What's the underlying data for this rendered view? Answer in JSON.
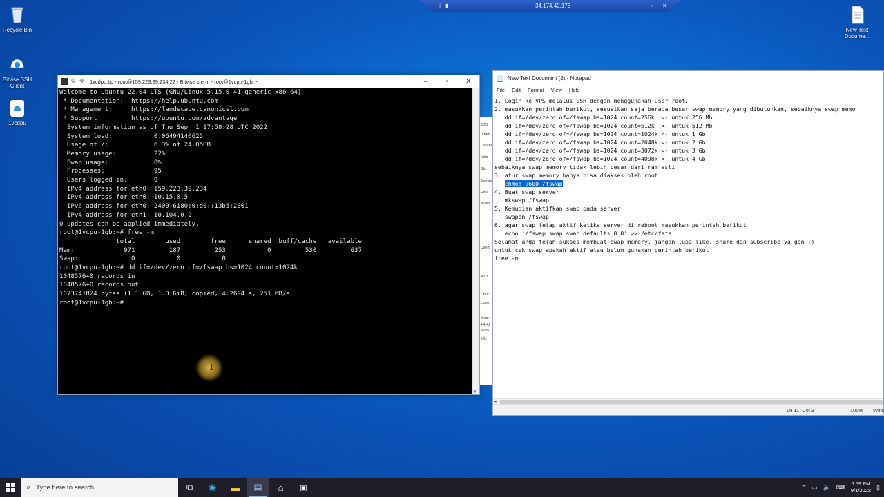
{
  "desktop": {
    "icons": [
      {
        "label": "Recycle Bin"
      },
      {
        "label": "Bitvise SSH Client"
      },
      {
        "label": "1vcdpu"
      },
      {
        "label": "New Text Docume..."
      }
    ]
  },
  "rdp_bar": {
    "host": "34.174.42.178"
  },
  "terminal": {
    "title": "1vcdpu.tlp - root@159.223.39.234:22 - Bitvise xterm - root@1vcpu-1gb: ~",
    "lines": [
      "Welcome to Ubuntu 22.04 LTS (GNU/Linux 5.15.0-41-generic x86_64)",
      "",
      " * Documentation:  https://help.ubuntu.com",
      " * Management:     https://landscape.canonical.com",
      " * Support:        https://ubuntu.com/advantage",
      "",
      "  System information as of Thu Sep  1 17:58:28 UTC 2022",
      "",
      "  System load:           0.06494140625",
      "  Usage of /:            6.3% of 24.05GB",
      "  Memory usage:          22%",
      "  Swap usage:            0%",
      "  Processes:             95",
      "  Users logged in:       0",
      "  IPv4 address for eth0: 159.223.39.234",
      "  IPv4 address for eth0: 10.15.0.5",
      "  IPv6 address for eth0: 2400:6180:0:d0::13b5:2001",
      "  IPv4 address for eth1: 10.104.0.2",
      "",
      "0 updates can be applied immediately.",
      "",
      "",
      "root@1vcpu-1gb:~# free -m",
      "               total        used        free      shared  buff/cache   available",
      "Mem:             971         187         253           0         530         637",
      "Swap:              0           0           0",
      "root@1vcpu-1gb:~# dd if=/dev/zero of=/fswap bs=1024 count=1024k",
      "1048576+0 records in",
      "1048576+0 records out",
      "1073741824 bytes (1.1 GB, 1.0 GiB) copied, 4.2694 s, 251 MB/s",
      "root@1vcpu-1gb:~# "
    ]
  },
  "background_window": {
    "fragments": [
      "C2S",
      "uthen",
      "Userna",
      "nitial",
      "Sto",
      "Passw",
      "Ena",
      "levati",
      "Client",
      "4:03",
      "Ubur",
      "c pro",
      "ithm:",
      "+4yU",
      "e255",
      "+0x"
    ]
  },
  "notepad": {
    "title": "New Text Document (2) - Notepad",
    "menu": [
      "File",
      "Edit",
      "Format",
      "View",
      "Help"
    ],
    "lines": [
      "1. Login ke VPS melalui SSH dengan menggunakan user root.",
      "2. masukkan perintah berikut, sesuaikan saja berapa besar swap memory yang dibutuhkan, sebaiknya swap memo",
      "   dd if=/dev/zero of=/fswap bs=1024 count=256k  <- untuk 256 Mb",
      "   dd if=/dev/zero of=/fswap bs=1024 count=512k  <- untuk 512 Mb",
      "   dd if=/dev/zero of=/fswap bs=1024 count=1024k <- untuk 1 Gb",
      "   dd if=/dev/zero of=/fswap bs=1024 count=2048k <- untuk 2 Gb",
      "   dd if=/dev/zero of=/fswap bs=1024 count=3072k <- untuk 3 Gb",
      "   dd if=/dev/zero of=/fswap bs=1024 count=4098k <- untuk 4 Gb",
      "sebaiknya swap memory tidak lebih besar dari ram asli",
      "3. atur swap memory hanya bisa diakses oleh root",
      "   chmod 0600 /fswap",
      "",
      "4. Buat swap server",
      "   mkswap /fswap",
      "5. Kemudian aktifkan swap pada server",
      "   swapon /fswap",
      "",
      "6. agar swap tetap aktif ketika server di reboot masukkan perintah berikut",
      "   echo '/fswap swap swap defaults 0 0' >> /etc/fsta",
      "",
      "Selamat anda telah sukses membuat swap memory, jangan lupa like, share dan subscribe ya gan :)",
      "",
      "untuk cek swap apakah aktif atau belum gunakan perintah berikut",
      "",
      "free -m"
    ],
    "selected_line_index": 10,
    "status": {
      "position": "Ln 11, Col 3",
      "zoom": "100%",
      "eol": "Wind"
    }
  },
  "taskbar": {
    "search_placeholder": "Type here to search",
    "clock_time": "5:59 PM",
    "clock_date": "9/1/2022"
  }
}
